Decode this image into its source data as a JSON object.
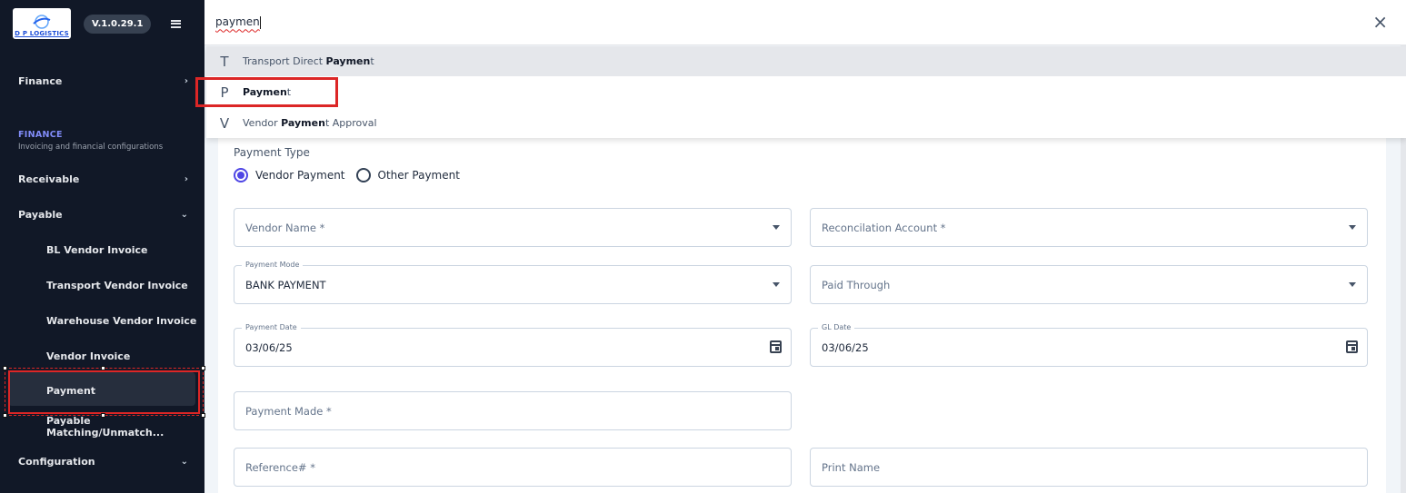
{
  "app": {
    "logo_text": "D P LOGISTICS",
    "version": "V.1.0.29.1"
  },
  "sidebar": {
    "top_item": "Finance",
    "section_title": "FINANCE",
    "section_subtitle": "Invoicing and financial configurations",
    "items": [
      {
        "label": "Receivable",
        "chevron": "›"
      },
      {
        "label": "Payable",
        "chevron": "⌄"
      },
      {
        "label": "BL Vendor Invoice"
      },
      {
        "label": "Transport Vendor Invoice"
      },
      {
        "label": "Warehouse Vendor Invoice"
      },
      {
        "label": "Vendor Invoice"
      },
      {
        "label": "Payment"
      },
      {
        "label": "Payable Matching/Unmatch..."
      },
      {
        "label": "Configuration",
        "chevron": "⌄"
      }
    ]
  },
  "search": {
    "query": "paymen",
    "close_icon": "×",
    "results": [
      {
        "letter": "T",
        "prefix": "Transport Direct ",
        "match": "Paymen",
        "suffix": "t"
      },
      {
        "letter": "P",
        "prefix": "",
        "match": "Paymen",
        "suffix": "t"
      },
      {
        "letter": "V",
        "prefix": "Vendor ",
        "match": "Paymen",
        "suffix": "t Approval"
      }
    ]
  },
  "form": {
    "payment_type_label": "Payment Type",
    "radio_vendor": "Vendor Payment",
    "radio_other": "Other Payment",
    "vendor_name": "Vendor Name *",
    "reconcilation_account": "Reconcilation Account *",
    "payment_mode_label": "Payment Mode",
    "payment_mode_value": "BANK PAYMENT",
    "paid_through": "Paid Through",
    "payment_date_label": "Payment Date",
    "payment_date_value": "03/06/25",
    "gl_date_label": "GL Date",
    "gl_date_value": "03/06/25",
    "payment_made": "Payment Made *",
    "reference": "Reference# *",
    "print_name": "Print Name"
  },
  "colors": {
    "sidebar_bg": "#111827",
    "accent": "#4f46e5",
    "annotation_red": "#dc2626"
  }
}
